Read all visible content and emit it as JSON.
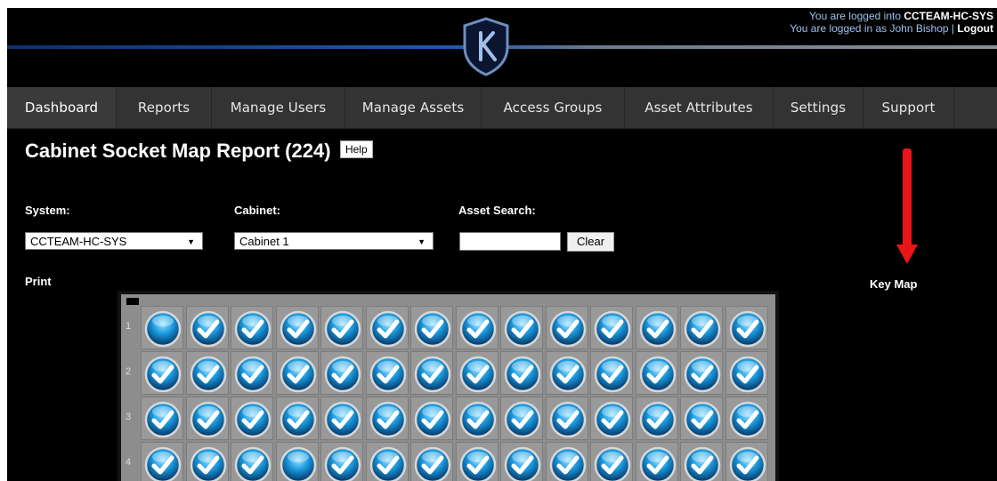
{
  "header": {
    "login_line1_prefix": "You are logged into ",
    "system_name": "CCTEAM-HC-SYS",
    "login_line2_prefix": "You are logged in as  John Bishop  |  ",
    "logout_label": "Logout",
    "logo_icon": "shield-k-logo-icon"
  },
  "nav": {
    "items": [
      {
        "label": "Dashboard",
        "active": true
      },
      {
        "label": "Reports"
      },
      {
        "label": "Manage Users"
      },
      {
        "label": "Manage Assets"
      },
      {
        "label": "Access Groups"
      },
      {
        "label": "Asset Attributes"
      },
      {
        "label": "Settings"
      },
      {
        "label": "Support"
      }
    ]
  },
  "page": {
    "title": "Cabinet Socket Map Report (224)",
    "help_label": "Help",
    "system_label": "System:",
    "system_value": "CCTEAM-HC-SYS",
    "cabinet_label": "Cabinet:",
    "cabinet_value": "Cabinet 1",
    "asset_search_label": "Asset Search:",
    "asset_search_value": "",
    "clear_label": "Clear",
    "print_label": "Print",
    "keymap_label": "Key Map",
    "arrow_color": "#e8161a"
  },
  "socket_map": {
    "rows": [
      {
        "num": "1",
        "sockets": [
          "empty",
          "checked",
          "checked",
          "checked",
          "checked",
          "checked",
          "checked",
          "checked",
          "checked",
          "checked",
          "checked",
          "checked",
          "checked",
          "checked"
        ]
      },
      {
        "num": "2",
        "sockets": [
          "checked",
          "checked",
          "checked",
          "checked",
          "checked",
          "checked",
          "checked",
          "checked",
          "checked",
          "checked",
          "checked",
          "checked",
          "checked",
          "checked"
        ]
      },
      {
        "num": "3",
        "sockets": [
          "checked",
          "checked",
          "checked",
          "checked",
          "checked",
          "checked",
          "checked",
          "checked",
          "checked",
          "checked",
          "checked",
          "checked",
          "checked",
          "checked"
        ]
      },
      {
        "num": "4",
        "sockets": [
          "checked",
          "checked",
          "checked",
          "empty",
          "checked",
          "checked",
          "checked",
          "checked",
          "checked",
          "checked",
          "checked",
          "checked",
          "checked",
          "checked"
        ]
      }
    ]
  }
}
